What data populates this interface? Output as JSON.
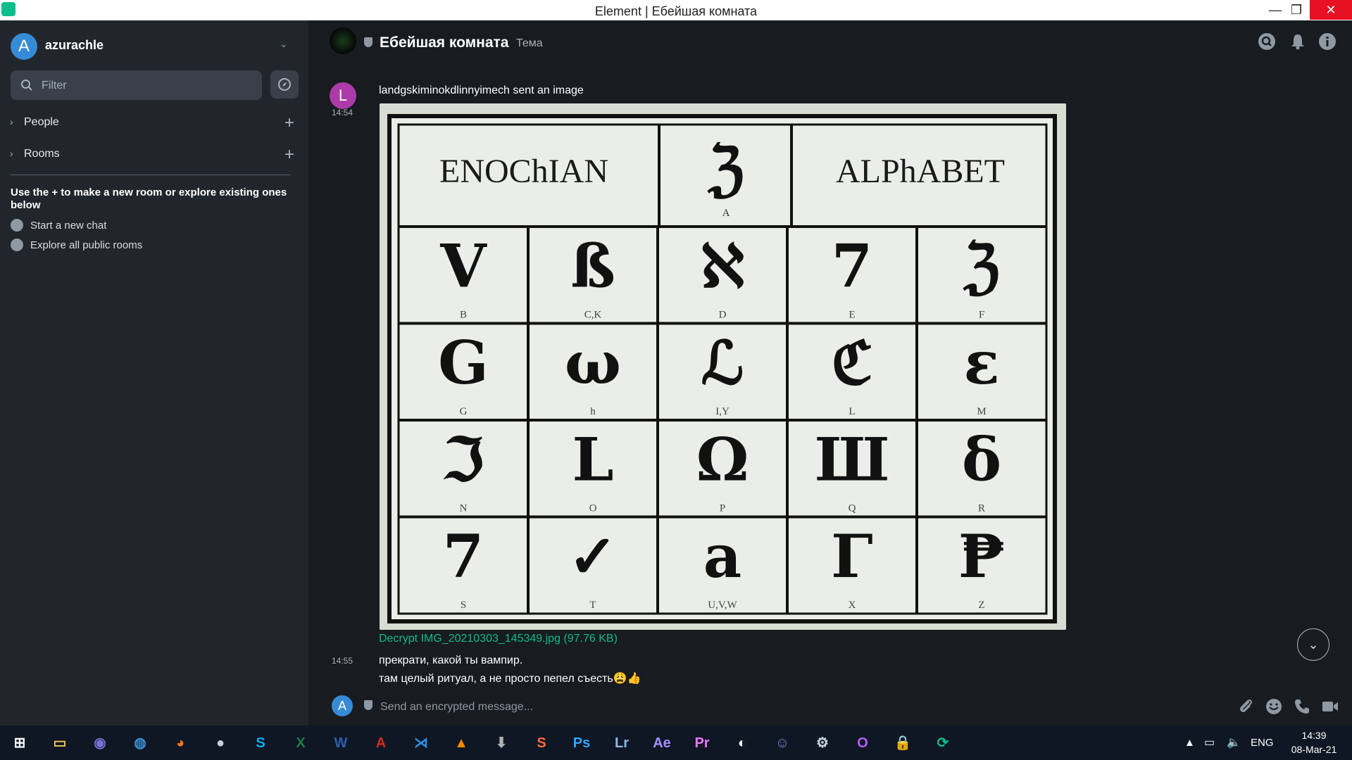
{
  "window": {
    "title": "Element | Ебейшая комната",
    "minimize_glyph": "—",
    "restore_glyph": "❐",
    "close_glyph": "✕"
  },
  "sidebar": {
    "user_initial": "A",
    "username": "azurachle",
    "user_menu_glyph": "⌄",
    "filter_placeholder": "Filter",
    "sections": [
      {
        "label": "People",
        "chevron": "›",
        "add_glyph": "+"
      },
      {
        "label": "Rooms",
        "chevron": "›",
        "add_glyph": "+"
      }
    ],
    "hint": "Use the + to make a new room or explore existing ones below",
    "links": [
      {
        "label": "Start a new chat",
        "icon": "chat-bubble-icon"
      },
      {
        "label": "Explore all public rooms",
        "icon": "compass-icon"
      }
    ]
  },
  "room": {
    "name": "Ебейшая комната",
    "topic": "Тема",
    "header_icons": [
      "search-icon",
      "bell-icon",
      "info-icon"
    ]
  },
  "timeline": {
    "sender_initial": "L",
    "sender_line": "landgskiminokdlinnyimech sent an image",
    "ts1": "14:54",
    "image": {
      "header_left": "ENOChIAN",
      "header_right": "ALPhABET",
      "header_mid_letter": "A",
      "letters": [
        "B",
        "C,K",
        "D",
        "E",
        "F",
        "G",
        "h",
        "I,Y",
        "L",
        "M",
        "N",
        "O",
        "P",
        "Q",
        "R",
        "S",
        "T",
        "U,V,W",
        "X",
        "Z"
      ],
      "glyphs": [
        "V",
        "ß",
        "ℵ",
        "7",
        "ℨ",
        "G",
        "ω",
        "ℒ",
        "ℭ",
        "ε",
        "ℑ",
        "L",
        "Ω",
        "Ш",
        "δ",
        "7",
        "✓",
        "a",
        "Γ",
        "₱"
      ]
    },
    "decrypt_link": "Decrypt IMG_20210303_145349.jpg (97.76 KB)",
    "ts2": "14:55",
    "msg1": "прекрати, какой ты вампир.",
    "msg2": "там целый ритуал, а не просто пепел съесть😩👍",
    "scroll_glyph": "⌄"
  },
  "composer": {
    "user_initial": "A",
    "placeholder": "Send an encrypted message...",
    "icons": [
      "paperclip-icon",
      "emoji-icon",
      "phone-icon",
      "video-icon"
    ]
  },
  "taskbar": {
    "apps": [
      {
        "name": "start",
        "glyph": "⊞",
        "color": "#ffffff"
      },
      {
        "name": "file-explorer",
        "glyph": "▭",
        "color": "#f2c94c"
      },
      {
        "name": "bittorrent",
        "glyph": "◉",
        "color": "#7b6fd6"
      },
      {
        "name": "browser-blue",
        "glyph": "◍",
        "color": "#3a8fd8"
      },
      {
        "name": "firefox",
        "glyph": "◕",
        "color": "#ff7a1a"
      },
      {
        "name": "moon",
        "glyph": "●",
        "color": "#c8d0e0"
      },
      {
        "name": "skype",
        "glyph": "S",
        "color": "#00aff0"
      },
      {
        "name": "excel",
        "glyph": "X",
        "color": "#1d7a45"
      },
      {
        "name": "word",
        "glyph": "W",
        "color": "#2b5fb4"
      },
      {
        "name": "acrobat",
        "glyph": "A",
        "color": "#d22a20"
      },
      {
        "name": "vscode",
        "glyph": "⋊",
        "color": "#2f8ee8"
      },
      {
        "name": "vlc",
        "glyph": "▲",
        "color": "#ff8800"
      },
      {
        "name": "download",
        "glyph": "⬇",
        "color": "#b0b0b0"
      },
      {
        "name": "sublime",
        "glyph": "S",
        "color": "#ff6a3d"
      },
      {
        "name": "photoshop",
        "glyph": "Ps",
        "color": "#31a8ff"
      },
      {
        "name": "lightroom",
        "glyph": "Lr",
        "color": "#8fb8e8"
      },
      {
        "name": "after-effects",
        "glyph": "Ae",
        "color": "#a58cff"
      },
      {
        "name": "premiere",
        "glyph": "Pr",
        "color": "#ea77ff"
      },
      {
        "name": "obs",
        "glyph": "◐",
        "color": "#ffffff"
      },
      {
        "name": "discord",
        "glyph": "☺",
        "color": "#7289da"
      },
      {
        "name": "steam",
        "glyph": "⚙",
        "color": "#c7d5e0"
      },
      {
        "name": "opera",
        "glyph": "O",
        "color": "#b45cff"
      },
      {
        "name": "vpn",
        "glyph": "🔒",
        "color": "#5a7bd6"
      },
      {
        "name": "element",
        "glyph": "⟳",
        "color": "#0dbd8b"
      }
    ],
    "tray_arrow": "▲",
    "language": "ENG",
    "time": "14:39",
    "date": "08-Mar-21"
  },
  "colors": {
    "accent": "#0dbd8b",
    "sidebar_bg": "#21262c",
    "main_bg": "#181b20",
    "user_avatar": "#368bd6",
    "sender_avatar": "#ac3ba8"
  }
}
